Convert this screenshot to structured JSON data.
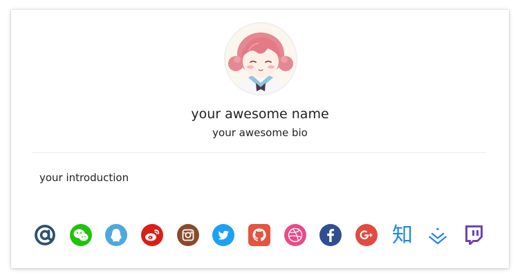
{
  "profile": {
    "name": "your awesome name",
    "bio": "your awesome bio",
    "introduction": "your introduction",
    "avatar_alt": "anime avatar"
  },
  "social": {
    "icons": [
      {
        "name": "email-icon",
        "color": "#2d4f72"
      },
      {
        "name": "wechat-icon",
        "color": "#20c30b"
      },
      {
        "name": "qq-icon",
        "color": "#4ea8df"
      },
      {
        "name": "weibo-icon",
        "color": "#d91f16"
      },
      {
        "name": "instagram-icon",
        "color": "#8a4a2b"
      },
      {
        "name": "twitter-icon",
        "color": "#1da1f2"
      },
      {
        "name": "github-icon",
        "color": "#e5543f"
      },
      {
        "name": "dribbble-icon",
        "color": "#e94b86"
      },
      {
        "name": "facebook-icon",
        "color": "#2f4f90"
      },
      {
        "name": "google-plus-icon",
        "color": "#e24b3f"
      },
      {
        "name": "zhihu-icon",
        "color": "#1b89ea",
        "label": "知"
      },
      {
        "name": "juejin-icon",
        "color": "#1e80ff"
      },
      {
        "name": "twitch-icon",
        "color": "#6f41b8"
      }
    ]
  }
}
